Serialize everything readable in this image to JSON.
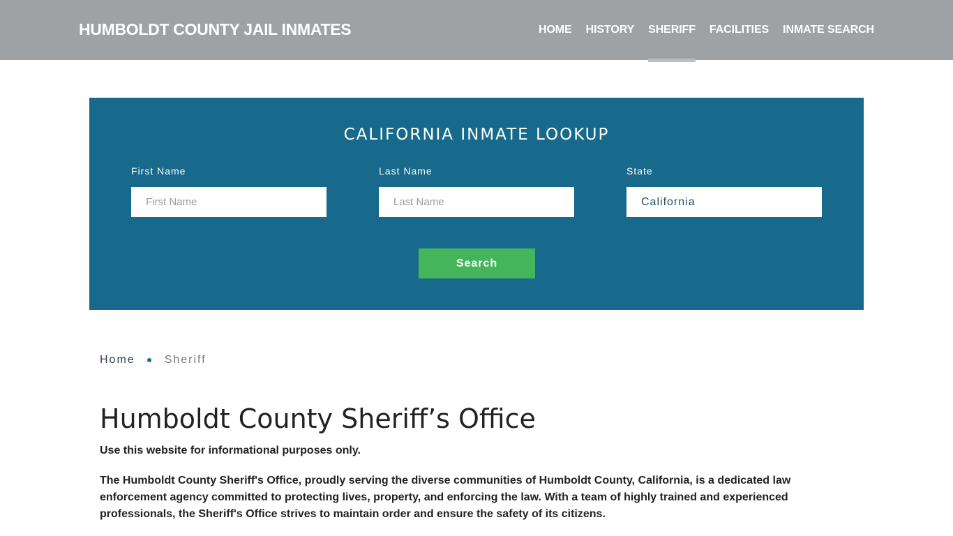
{
  "header": {
    "brand": "HUMBOLDT COUNTY JAIL INMATES",
    "nav": [
      {
        "label": "HOME",
        "active": false
      },
      {
        "label": "HISTORY",
        "active": false
      },
      {
        "label": "SHERIFF",
        "active": true
      },
      {
        "label": "FACILITIES",
        "active": false
      },
      {
        "label": "INMATE SEARCH",
        "active": false
      }
    ]
  },
  "lookup": {
    "title": "CALIFORNIA INMATE LOOKUP",
    "first_name": {
      "label": "First Name",
      "placeholder": "First Name",
      "value": ""
    },
    "last_name": {
      "label": "Last Name",
      "placeholder": "Last Name",
      "value": ""
    },
    "state": {
      "label": "State",
      "value": "California"
    },
    "search_label": "Search"
  },
  "breadcrumb": {
    "home": "Home",
    "current": "Sheriff"
  },
  "content": {
    "title": "Humboldt County Sheriff’s Office",
    "intro": "Use this website for informational purposes only.",
    "paragraph": "The Humboldt County Sheriff's Office, proudly serving the diverse communities of Humboldt County, California, is a dedicated law enforcement agency committed to protecting lives, property, and enforcing the law. With a team of highly trained and experienced professionals, the Sheriff's Office strives to maintain order and ensure the safety of its citizens."
  },
  "colors": {
    "navbar": "#9ea2a5",
    "lookup_bg": "#186a8c",
    "search_button": "#44b55a",
    "active_indicator": "#bcbfc1"
  }
}
